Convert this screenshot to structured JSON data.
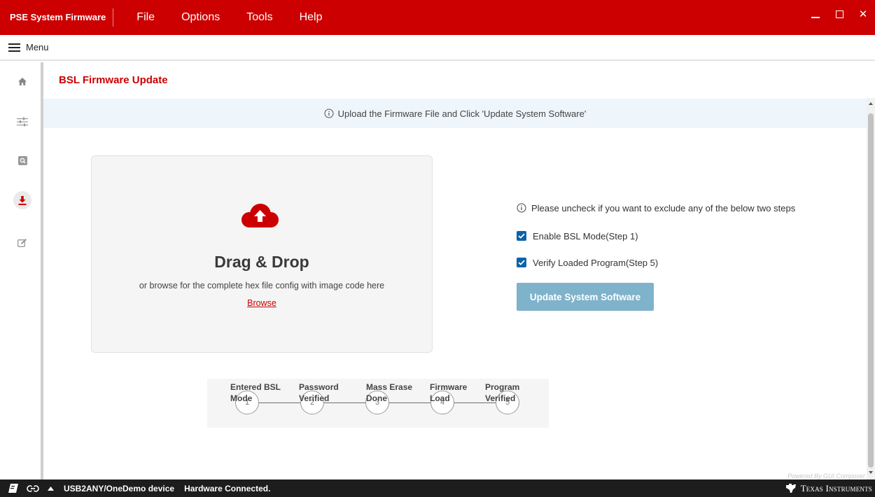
{
  "window": {
    "app_name": "PSE System Firmware",
    "menus": [
      "File",
      "Options",
      "Tools",
      "Help"
    ],
    "close_glyph": "✕"
  },
  "menubar": {
    "label": "Menu"
  },
  "sidebar": {
    "items": [
      {
        "icon": "home-icon"
      },
      {
        "icon": "sliders-icon"
      },
      {
        "icon": "search-box-icon"
      },
      {
        "icon": "download-icon",
        "active": true
      },
      {
        "icon": "edit-icon"
      }
    ]
  },
  "page": {
    "title": "BSL Firmware Update",
    "banner": "Upload the Firmware File and Click 'Update System Software'"
  },
  "dropzone": {
    "title": "Drag & Drop",
    "subtitle": "or browse for the complete hex file config with image code here",
    "browse": "Browse"
  },
  "options": {
    "note": "Please uncheck if you want to exclude any of the below two steps",
    "enable_bsl": {
      "label": "Enable BSL Mode(Step 1)",
      "checked": true
    },
    "verify_program": {
      "label": "Verify Loaded Program(Step 5)",
      "checked": true
    },
    "update_button": "Update System Software"
  },
  "steps": [
    {
      "number": "1",
      "label": "Entered BSL\nMode"
    },
    {
      "number": "2",
      "label": "Password\nVerified"
    },
    {
      "number": "3",
      "label": "Mass Erase\nDone"
    },
    {
      "number": "4",
      "label": "Firmware\nLoad"
    },
    {
      "number": "5",
      "label": "Program\nVerified"
    }
  ],
  "footer": {
    "powered_by": "Powered By GUI Composer"
  },
  "statusbar": {
    "device": "USB2ANY/OneDemo device",
    "status": "Hardware Connected.",
    "brand": "Texas Instruments"
  },
  "colors": {
    "brand_red": "#cc0000",
    "checkbox_blue": "#0b63a8",
    "button_disabled": "#7fb2cb",
    "banner_bg": "#eef5fb"
  }
}
